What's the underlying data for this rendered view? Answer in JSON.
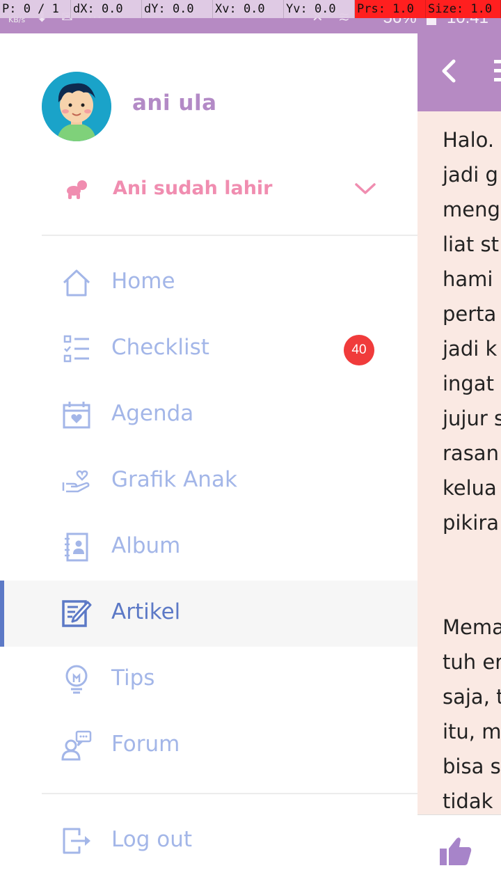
{
  "debug": {
    "p": "P: 0 / 1",
    "dx": "dX: 0.0",
    "dy": "dY: 0.0",
    "xv": "Xv: 0.0",
    "yv": "Yv: 0.0",
    "prs": "Prs: 1.0",
    "size": "Size: 1.0"
  },
  "status_bar": {
    "speed_unit": "KB/s",
    "battery": "56%",
    "time": "10:41"
  },
  "drawer": {
    "user_name": "ani ula",
    "child_status": "Ani sudah lahir",
    "menu": [
      {
        "label": "Home",
        "icon": "home-icon"
      },
      {
        "label": "Checklist",
        "icon": "checklist-icon",
        "badge": "40"
      },
      {
        "label": "Agenda",
        "icon": "calendar-heart-icon"
      },
      {
        "label": "Grafik Anak",
        "icon": "hand-heart-icon"
      },
      {
        "label": "Album",
        "icon": "album-icon"
      },
      {
        "label": "Artikel",
        "icon": "article-edit-icon",
        "active": true
      },
      {
        "label": "Tips",
        "icon": "lightbulb-icon"
      },
      {
        "label": "Forum",
        "icon": "forum-icon"
      }
    ],
    "logout_label": "Log out"
  },
  "background_article": {
    "lines_para1": [
      "Halo.",
      "jadi g",
      "meng",
      "liat st",
      "hami",
      "perta",
      "jadi k",
      "ingat",
      "jujur s",
      "rasan",
      "kelua",
      "pikira"
    ],
    "lines_para2": [
      "Mema",
      "tuh er",
      "saja, t",
      "itu, m",
      "bisa s",
      "tidak"
    ]
  },
  "colors": {
    "accent_purple": "#b68ac3",
    "menu_blue": "#a3b6e8",
    "active_blue": "#5c79c6",
    "pink": "#f08db0",
    "badge_red": "#f03b3b",
    "article_bg": "#fae9e3"
  }
}
